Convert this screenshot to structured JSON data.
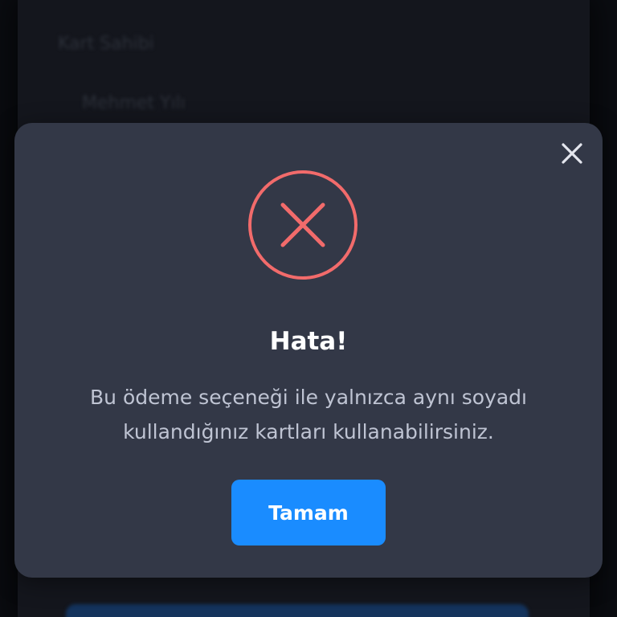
{
  "background": {
    "label": "Kart Sahibi",
    "sublabel": "Mehmet Yılı"
  },
  "dialog": {
    "close_icon": "close-icon",
    "status_icon": "error-circle-x-icon",
    "title": "Hata!",
    "message": "Bu ödeme seçeneği ile yalnızca aynı soyadı kullandığınız kartları kullanabilirsiniz.",
    "ok_label": "Tamam"
  },
  "colors": {
    "error": "#f26b6b",
    "primary": "#1a8cff",
    "dialog_bg": "#333847"
  }
}
